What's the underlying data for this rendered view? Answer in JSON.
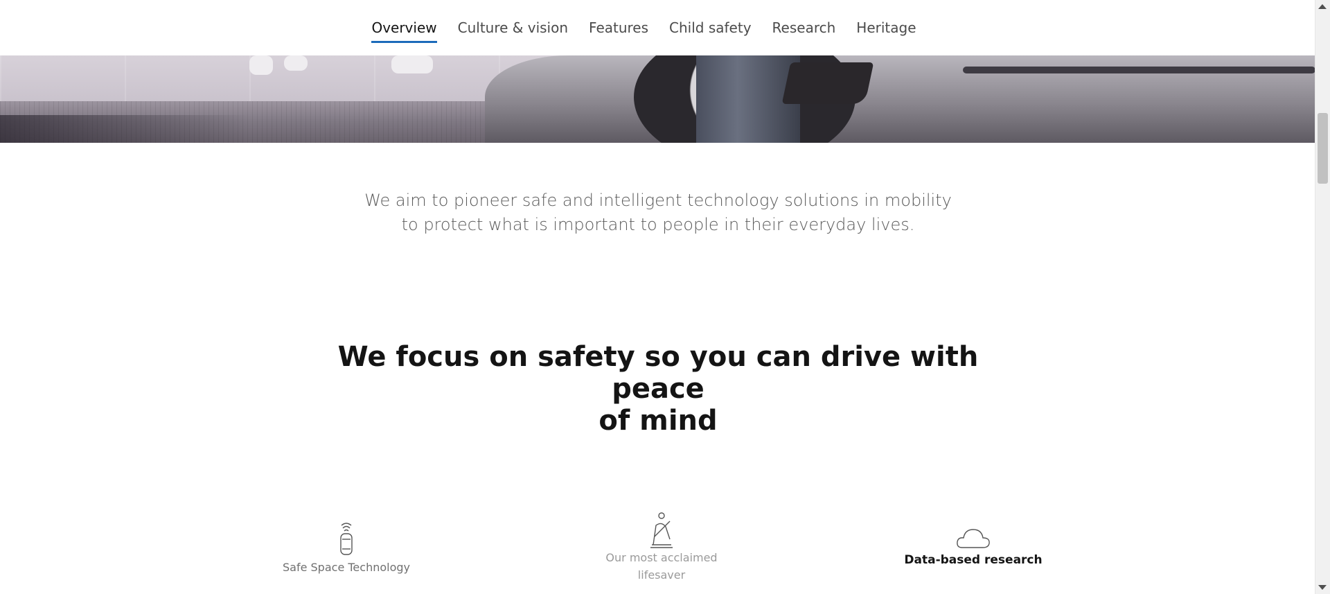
{
  "nav": {
    "items": [
      {
        "label": "Overview",
        "active": true
      },
      {
        "label": "Culture & vision",
        "active": false
      },
      {
        "label": "Features",
        "active": false
      },
      {
        "label": "Child safety",
        "active": false
      },
      {
        "label": "Research",
        "active": false
      },
      {
        "label": "Heritage",
        "active": false
      }
    ],
    "active_color": "#1c6bba"
  },
  "intro": {
    "line1": "We aim to pioneer safe and intelligent technology solutions in mobility",
    "line2": "to protect what is important to people in their everyday lives."
  },
  "headline": {
    "line1": "We focus on safety so you can drive with peace",
    "line2": "of mind"
  },
  "features": [
    {
      "label": "Safe Space Technology",
      "icon": "car-radar-icon"
    },
    {
      "label_line1": "Our most acclaimed",
      "label_line2": "lifesaver",
      "icon": "seatbelt-icon"
    },
    {
      "label": "Data-based research",
      "icon": "cloud-icon",
      "active": true
    }
  ]
}
